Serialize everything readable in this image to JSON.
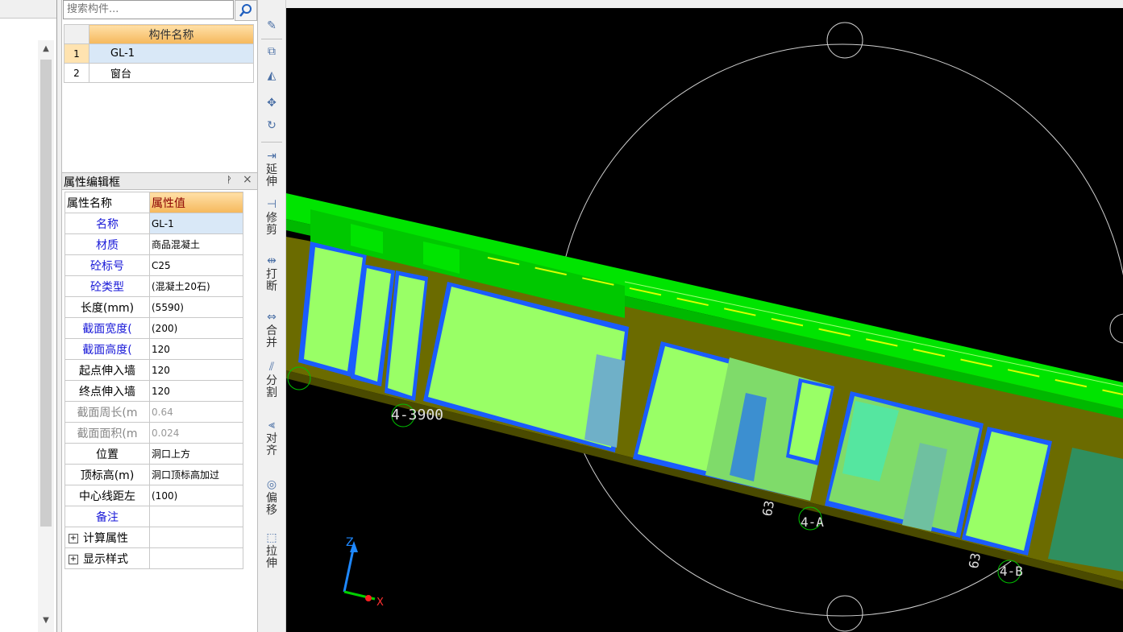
{
  "search": {
    "placeholder": "搜索构件..."
  },
  "component_list": {
    "header": "构件名称",
    "items": [
      {
        "index": "1",
        "name": "GL-1",
        "selected": true
      },
      {
        "index": "2",
        "name": "窗台",
        "selected": false
      }
    ]
  },
  "properties": {
    "panel_title": "属性编辑框",
    "col_name": "属性名称",
    "col_value": "属性值",
    "rows": [
      {
        "name": "名称",
        "value": "GL-1",
        "style": "blue"
      },
      {
        "name": "材质",
        "value": "商品混凝土",
        "style": "blue"
      },
      {
        "name": "砼标号",
        "value": "C25",
        "style": "blue"
      },
      {
        "name": "砼类型",
        "value": "(混凝土20石)",
        "style": "blue"
      },
      {
        "name": "长度(mm)",
        "value": "(5590)",
        "style": "black"
      },
      {
        "name": "截面宽度(",
        "value": "(200)",
        "style": "blue"
      },
      {
        "name": "截面高度(",
        "value": "120",
        "style": "blue"
      },
      {
        "name": "起点伸入墙",
        "value": "120",
        "style": "black"
      },
      {
        "name": "终点伸入墙",
        "value": "120",
        "style": "black"
      },
      {
        "name": "截面周长(m",
        "value": "0.64",
        "style": "gray"
      },
      {
        "name": "截面面积(m",
        "value": "0.024",
        "style": "gray"
      },
      {
        "name": "位置",
        "value": "洞口上方",
        "style": "black"
      },
      {
        "name": "顶标高(m)",
        "value": "洞口顶标高加过",
        "style": "black"
      },
      {
        "name": "中心线距左",
        "value": "(100)",
        "style": "black"
      },
      {
        "name": "备注",
        "value": "",
        "style": "blue"
      }
    ],
    "groups": [
      "计算属性",
      "显示样式"
    ]
  },
  "vertical_toolbar": [
    {
      "label": "延伸",
      "icon": "extend-icon"
    },
    {
      "label": "修剪",
      "icon": "trim-icon"
    },
    {
      "label": "打断",
      "icon": "break-icon"
    },
    {
      "label": "合并",
      "icon": "merge-icon"
    },
    {
      "label": "分割",
      "icon": "split-icon"
    },
    {
      "label": "对齐",
      "icon": "align-icon"
    },
    {
      "label": "偏移",
      "icon": "offset-icon"
    },
    {
      "label": "拉伸",
      "icon": "stretch-icon"
    }
  ],
  "viewport": {
    "axis_labels": [
      "4-3900",
      "4-A",
      "4-B",
      "63",
      "63"
    ],
    "axis_z": "Z",
    "axis_x": "X"
  },
  "colors": {
    "beam_green": "#00e400",
    "wall_olive": "#6b6b00",
    "window_light_green": "#99ff66",
    "window_frame_blue": "#1a5cff",
    "viewport_bg": "#000000"
  }
}
